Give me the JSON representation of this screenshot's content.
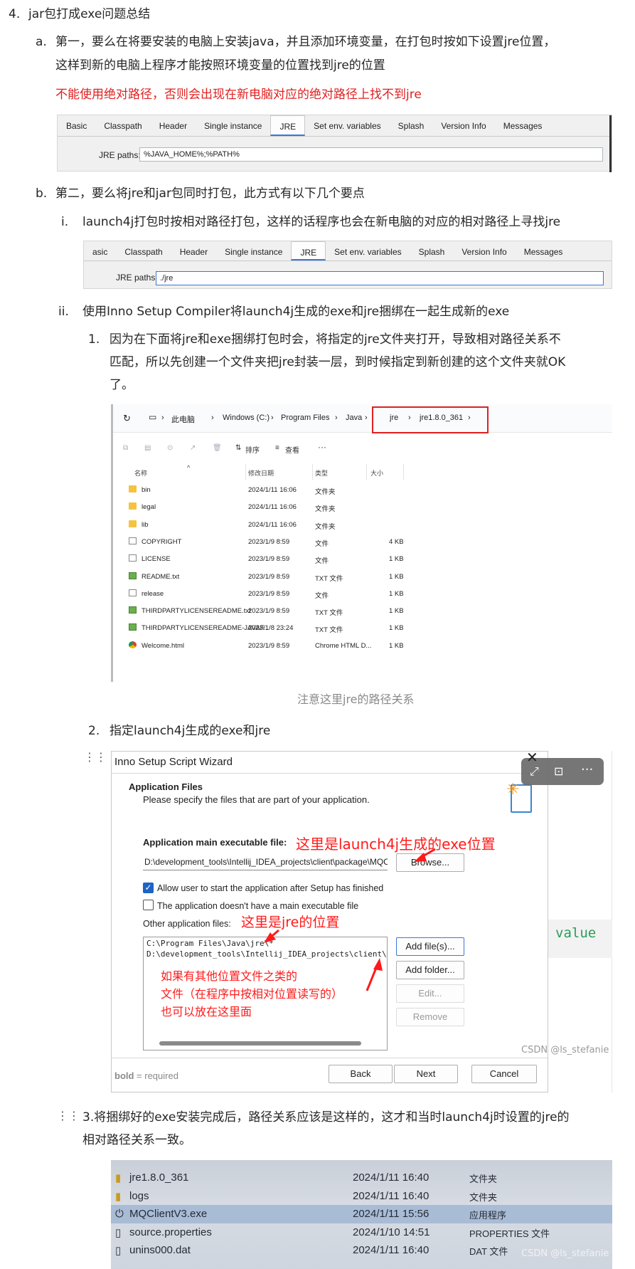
{
  "heading": {
    "num": "4.",
    "text": "jar包打成exe问题总结"
  },
  "item_a": {
    "marker": "a.",
    "line1": "第一，要么在将要安装的电脑上安装java，并且添加环境变量，在打包时按如下设置jre位置，",
    "line2": "这样到新的电脑上程序才能按照环境变量的位置找到jre的位置",
    "warning": "不能使用绝对路径，否则会出现在新电脑对应的绝对路径上找不到jre"
  },
  "l4j_tabs_1": [
    "Basic",
    "Classpath",
    "Header",
    "Single instance",
    "JRE",
    "Set env. variables",
    "Splash",
    "Version Info",
    "Messages"
  ],
  "l4j_1": {
    "label": "JRE paths:",
    "value": "%JAVA_HOME%;%PATH%"
  },
  "item_b": {
    "marker": "b.",
    "text": "第二，要么将jre和jar包同时打包，此方式有以下几个要点"
  },
  "item_b_i": {
    "marker": "i.",
    "text": "launch4j打包时按相对路径打包，这样的话程序也会在新电脑的对应的相对路径上寻找jre"
  },
  "l4j_tabs_2": [
    "asic",
    "Classpath",
    "Header",
    "Single instance",
    "JRE",
    "Set env. variables",
    "Splash",
    "Version Info",
    "Messages"
  ],
  "l4j_2": {
    "label": "JRE paths:",
    "value": "./jre"
  },
  "item_b_ii": {
    "marker": "ii.",
    "text": "使用Inno Setup Compiler将launch4j生成的exe和jre捆绑在一起生成新的exe"
  },
  "step1": {
    "marker": "1.",
    "line1": "因为在下面将jre和exe捆绑打包时会，将指定的jre文件夹打开，导致相对路径关系不",
    "line2": "匹配，所以先创建一个文件夹把jre封装一层，到时候指定到新创建的这个文件夹就OK",
    "line3": "了。"
  },
  "explorer": {
    "breadcrumb": [
      "此电脑",
      "Windows (C:)",
      "Program Files",
      "Java",
      "jre",
      "jre1.8.0_361"
    ],
    "sort_label": "排序",
    "view_label": "查看",
    "columns": [
      "名称",
      "修改日期",
      "类型",
      "大小"
    ],
    "rows": [
      {
        "icon": "folder",
        "name": "bin",
        "date": "2024/1/11 16:06",
        "type": "文件夹",
        "size": ""
      },
      {
        "icon": "folder",
        "name": "legal",
        "date": "2024/1/11 16:06",
        "type": "文件夹",
        "size": ""
      },
      {
        "icon": "folder",
        "name": "lib",
        "date": "2024/1/11 16:06",
        "type": "文件夹",
        "size": ""
      },
      {
        "icon": "file",
        "name": "COPYRIGHT",
        "date": "2023/1/9 8:59",
        "type": "文件",
        "size": "4 KB"
      },
      {
        "icon": "file",
        "name": "LICENSE",
        "date": "2023/1/9 8:59",
        "type": "文件",
        "size": "1 KB"
      },
      {
        "icon": "txt",
        "name": "README.txt",
        "date": "2023/1/9 8:59",
        "type": "TXT 文件",
        "size": "1 KB"
      },
      {
        "icon": "file",
        "name": "release",
        "date": "2023/1/9 8:59",
        "type": "文件",
        "size": "1 KB"
      },
      {
        "icon": "txt",
        "name": "THIRDPARTYLICENSEREADME.txt",
        "date": "2023/1/9 8:59",
        "type": "TXT 文件",
        "size": "1 KB"
      },
      {
        "icon": "txt",
        "name": "THIRDPARTYLICENSEREADME-JAVAF...",
        "date": "2023/1/8 23:24",
        "type": "TXT 文件",
        "size": "1 KB"
      },
      {
        "icon": "chrome",
        "name": "Welcome.html",
        "date": "2023/1/9 8:59",
        "type": "Chrome HTML D...",
        "size": "1 KB"
      }
    ],
    "caption": "注意这里jre的路径关系"
  },
  "step2": {
    "marker": "2.",
    "text": "指定launch4j生成的exe和jre"
  },
  "wizard": {
    "title": "Inno Setup Script Wizard",
    "section_title": "Application Files",
    "section_desc": "Please specify the files that are part of your application.",
    "main_exe_label": "Application main executable file:",
    "main_exe_value": "D:\\development_tools\\Intellij_IDEA_projects\\client\\package\\MQCli",
    "browse": "Browse...",
    "chk_allow": "Allow user to start the application after Setup has finished",
    "chk_nomain": "The application doesn't have a main executable file",
    "other_label": "Other application files:",
    "files": [
      "C:\\Program Files\\Java\\jre\\*",
      "D:\\development_tools\\Intellij_IDEA_projects\\client\\package\\source"
    ],
    "add_files": "Add file(s)...",
    "add_folder": "Add folder...",
    "edit": "Edit...",
    "remove": "Remove",
    "bold_req_b": "bold",
    "bold_req_rest": " = required",
    "back": "Back",
    "next": "Next",
    "cancel": "Cancel"
  },
  "annotations": {
    "exe": "这里是launch4j生成的exe位置",
    "jre": "这里是jre的位置",
    "other1": "如果有其他位置文件之类的",
    "other2": "文件（在程序中按相对位置读写的）",
    "other3": "也可以放在这里面"
  },
  "side_code": "value",
  "watermark": "CSDN @ls_stefanie",
  "step3": {
    "line1": "3.将捆绑好的exe安装完成后，路径关系应该是这样的，这才和当时launch4j时设置的jre的",
    "line2": "相对路径关系一致。"
  },
  "photo_rows": [
    {
      "name": "jre1.8.0_361",
      "date": "2024/1/11 16:40",
      "type": "文件夹"
    },
    {
      "name": "logs",
      "date": "2024/1/11 16:40",
      "type": "文件夹"
    },
    {
      "name": "MQClientV3.exe",
      "date": "2024/1/11 15:56",
      "type": "应用程序"
    },
    {
      "name": "source.properties",
      "date": "2024/1/10 14:51",
      "type": "PROPERTIES 文件"
    },
    {
      "name": "unins000.dat",
      "date": "2024/1/11 16:40",
      "type": "DAT 文件"
    }
  ]
}
